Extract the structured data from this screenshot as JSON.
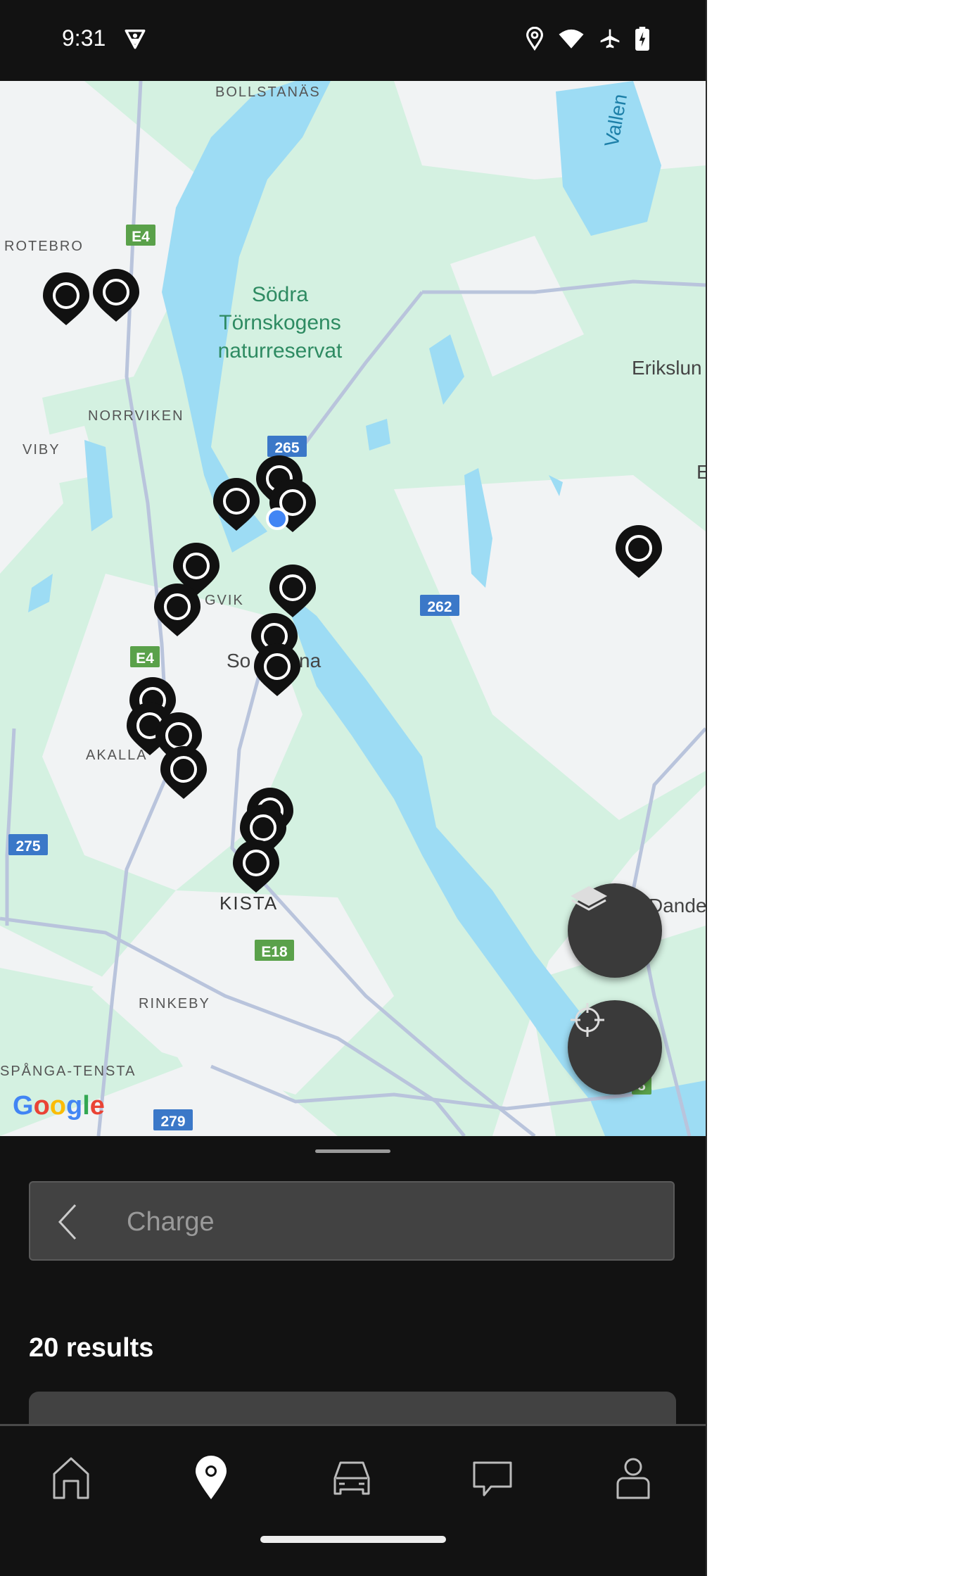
{
  "status_bar": {
    "time": "9:31",
    "icons": [
      "vpn-shield-icon",
      "location-icon",
      "wifi-icon",
      "airplane-icon",
      "battery-charging-icon"
    ]
  },
  "map": {
    "place_labels": [
      "BOLLSTANÄS",
      "ROTEBRO",
      "NORRVIKEN",
      "VIBY",
      "Södra",
      "Törnskogens",
      "naturreservat",
      "Vallen",
      "Erikslun",
      "E",
      "GVIK",
      "So",
      "na",
      "AKALLA",
      "KISTA",
      "RINKEBY",
      "SPÅNGA-TENSTA",
      "Dande"
    ],
    "road_shields": [
      "E4",
      "265",
      "262",
      "E4",
      "275",
      "E18",
      "279",
      "8"
    ],
    "attribution": "Google",
    "marker_count": 18,
    "colors": {
      "land": "#f1f3f4",
      "park": "#d4f1e1",
      "water": "#9ddcf4",
      "road": "#b9c4dc",
      "marker": "#111111",
      "user_location": "#4285f4"
    }
  },
  "fabs": {
    "layers": "layers-icon",
    "locate": "crosshair-icon"
  },
  "sheet": {
    "search_placeholder": "Charge",
    "results_label": "20 results"
  },
  "bottom_nav": {
    "items": [
      "home",
      "map",
      "car",
      "messages",
      "profile"
    ],
    "active": "map"
  }
}
